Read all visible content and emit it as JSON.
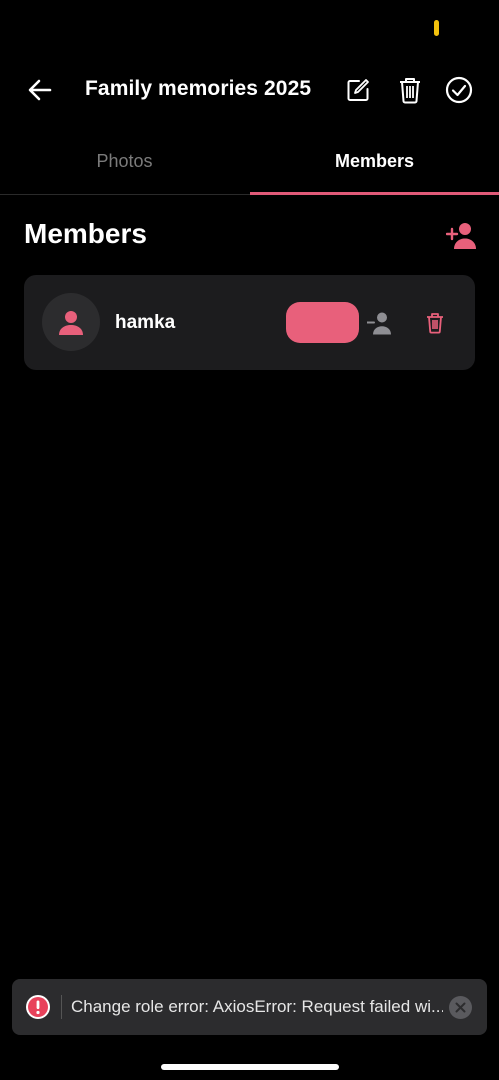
{
  "header": {
    "title": "Family memories 2025",
    "icons": {
      "back": "arrow-left-icon",
      "edit": "edit-icon",
      "delete": "trash-icon",
      "confirm": "check-circle-icon"
    }
  },
  "tabs": [
    {
      "label": "Photos",
      "active": false
    },
    {
      "label": "Members",
      "active": true
    }
  ],
  "members_section": {
    "title": "Members",
    "add_icon": "person-add-icon"
  },
  "members": [
    {
      "name": "hamka",
      "role_label": "",
      "avatar_icon": "person-icon",
      "remove_role_icon": "person-remove-icon",
      "delete_icon": "trash-icon"
    }
  ],
  "toast": {
    "message": "Change role error: AxiosError: Request failed wi...",
    "icon": "error-icon",
    "close_icon": "close-icon"
  },
  "colors": {
    "accent": "#e8607b",
    "background": "#000000",
    "card": "#1c1c1e",
    "status_dot": "#f4c20d"
  }
}
